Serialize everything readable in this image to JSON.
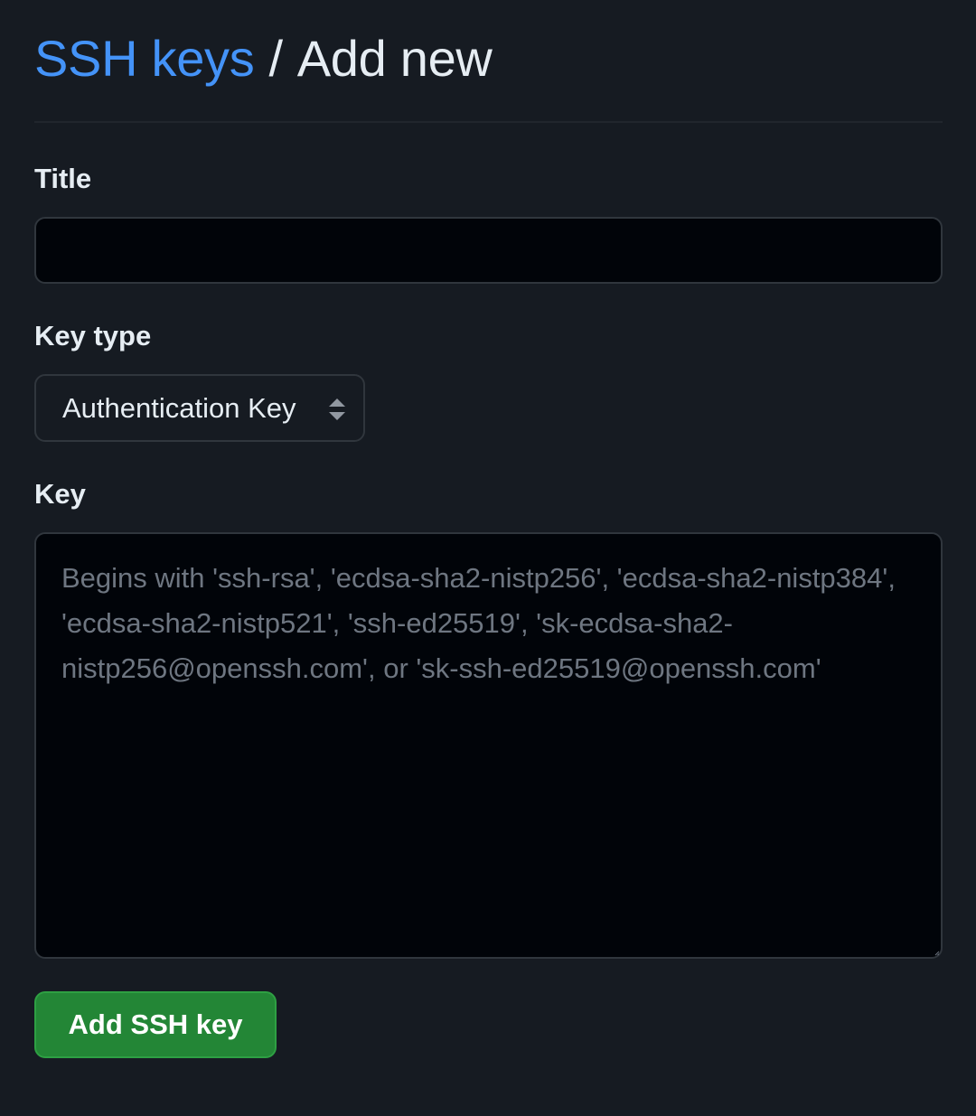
{
  "header": {
    "breadcrumb_link": "SSH keys",
    "separator": "/",
    "current": "Add new"
  },
  "form": {
    "title": {
      "label": "Title",
      "value": "",
      "placeholder": ""
    },
    "key_type": {
      "label": "Key type",
      "selected": "Authentication Key",
      "icon": "select-arrows-icon"
    },
    "key": {
      "label": "Key",
      "value": "",
      "placeholder": "Begins with 'ssh-rsa', 'ecdsa-sha2-nistp256', 'ecdsa-sha2-nistp384', 'ecdsa-sha2-nistp521', 'ssh-ed25519', 'sk-ecdsa-sha2-nistp256@openssh.com', or 'sk-ssh-ed25519@openssh.com'"
    },
    "submit_label": "Add SSH key"
  },
  "colors": {
    "background": "#161b22",
    "input_background": "#010409",
    "border": "#30363d",
    "link": "#4493f8",
    "primary_button": "#238636",
    "placeholder": "#6e7681"
  }
}
